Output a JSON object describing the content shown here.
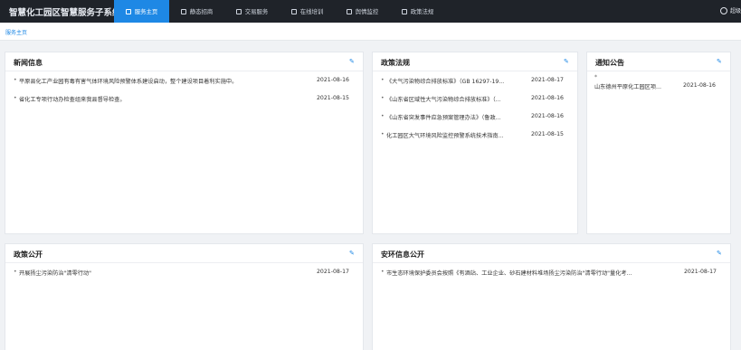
{
  "app": {
    "title": "智慧化工园区智慧服务子系统"
  },
  "nav": [
    {
      "label": "服务主页",
      "icon": "doc-icon",
      "active": true
    },
    {
      "label": "静态招商",
      "icon": "doc-icon",
      "active": false
    },
    {
      "label": "交易服务",
      "icon": "doc-icon",
      "active": false
    },
    {
      "label": "在线培训",
      "icon": "doc-icon",
      "active": false
    },
    {
      "label": "舆情监控",
      "icon": "doc-icon",
      "active": false
    },
    {
      "label": "政策法规",
      "icon": "doc-icon",
      "active": false
    }
  ],
  "user": {
    "label": "超级"
  },
  "breadcrumb": "服务主页",
  "panels": {
    "news": {
      "title": "新闻信息",
      "items": [
        {
          "text": "平原县化工产业园有毒有害气体环境风险预警体系建设启动，整个建设项目着利实施中。",
          "date": "2021-08-16"
        },
        {
          "text": "省化工专项行动办检查组来我县督导检查。",
          "date": "2021-08-15"
        }
      ]
    },
    "policy": {
      "title": "政策法规",
      "items": [
        {
          "text": "《大气污染物综合排放标准》（GB 16297-19...",
          "date": "2021-08-17"
        },
        {
          "text": "《山东省区域性大气污染物综合排放标准》（...",
          "date": "2021-08-16"
        },
        {
          "text": "《山东省突发事件应急预案管理办法》（鲁政...",
          "date": "2021-08-16"
        },
        {
          "text": "化工园区大气环境风险监控预警系统技术指南...",
          "date": "2021-08-15"
        }
      ]
    },
    "notice": {
      "title": "通知公告",
      "items": [
        {
          "text": "山东德州平原化工园区项...",
          "date": "2021-08-16"
        }
      ]
    },
    "policy_open": {
      "title": "政策公开",
      "items": [
        {
          "text": "开展扬尘污染防治\"清零行动\"",
          "date": "2021-08-17"
        }
      ]
    },
    "safety": {
      "title": "安环信息公开",
      "items": [
        {
          "text": "市生态环境保护委员会按照《有酒站、工业企业、砂石建材料堆场扬尘污染防治\"清零行动\"量化考...",
          "date": "2021-08-17"
        }
      ]
    }
  },
  "colors": {
    "topbar": "#1f2329",
    "accent": "#1e88e5",
    "background": "#f0f2f5"
  }
}
